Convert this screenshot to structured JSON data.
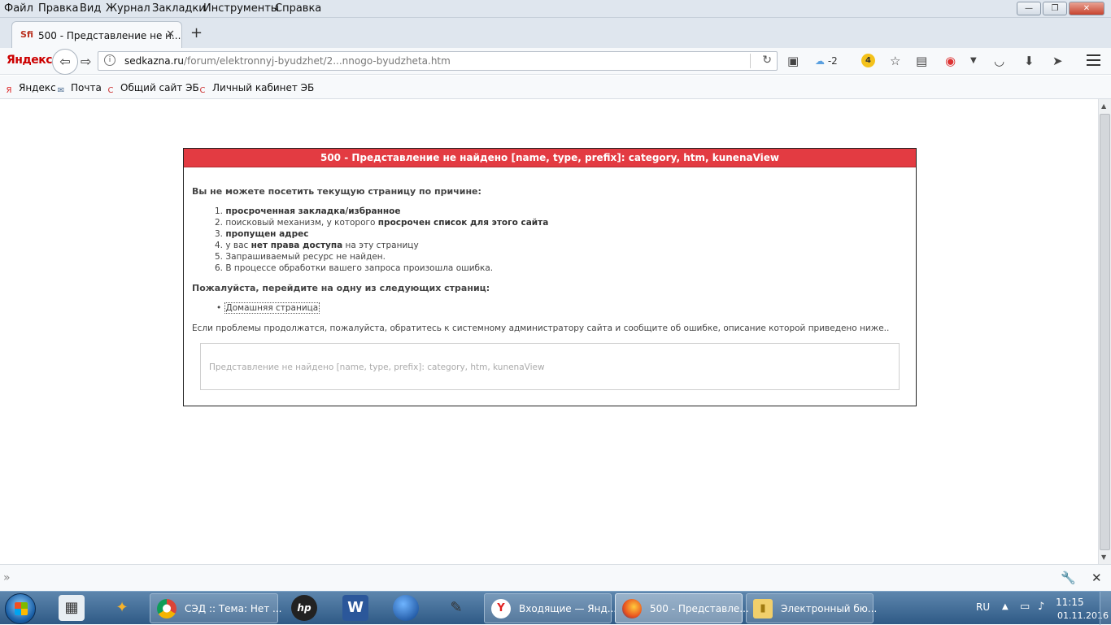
{
  "menu": {
    "items": [
      "Файл",
      "Правка",
      "Вид",
      "Журнал",
      "Закладки",
      "Инструменты",
      "Справка"
    ]
  },
  "window_controls": {
    "minimize": "—",
    "maximize": "❐",
    "close": "✕"
  },
  "tab": {
    "title": "500 - Представление не н...",
    "favicon": "Sfi",
    "close": "✕",
    "new_tab": "+"
  },
  "navbar": {
    "brand": "Яндекс",
    "back": "⇦",
    "forward": "⇨",
    "url_host": "sedkazna.ru",
    "url_path": "/forum/elektronnyj-byudzhet/2...nnogo-byudzheta.htm",
    "reload": "↻",
    "weather": "-2",
    "badge": "4"
  },
  "bookmarks": [
    {
      "label": "Яндекс",
      "icon": "yandex-icon",
      "glyph": "Я",
      "color": "#d22"
    },
    {
      "label": "Почта",
      "icon": "mail-icon",
      "glyph": "✉",
      "color": "#4a6a90"
    },
    {
      "label": "Общий сайт ЭБ",
      "icon": "eb-icon",
      "glyph": "C",
      "color": "#c33"
    },
    {
      "label": "Личный кабинет ЭБ",
      "icon": "eb-icon",
      "glyph": "C",
      "color": "#c33"
    }
  ],
  "error": {
    "header": "500 - Представление не найдено [name, type, prefix]: category, htm, kunenaView",
    "reason_title": "Вы не можете посетить текущую страницу по причине:",
    "reasons": [
      {
        "num": "1.",
        "pre": "",
        "bold": "просроченная закладка/избранное",
        "post": ""
      },
      {
        "num": "2.",
        "pre": "поисковый механизм, у которого ",
        "bold": "просрочен список для этого сайта",
        "post": ""
      },
      {
        "num": "3.",
        "pre": "",
        "bold": "пропущен адрес",
        "post": ""
      },
      {
        "num": "4.",
        "pre": "у вас ",
        "bold": "нет права доступа",
        "post": " на эту страницу"
      },
      {
        "num": "5.",
        "pre": "Запрашиваемый ресурс не найден.",
        "bold": "",
        "post": ""
      },
      {
        "num": "6.",
        "pre": "В процессе обработки вашего запроса произошла ошибка.",
        "bold": "",
        "post": ""
      }
    ],
    "goto_title": "Пожалуйста, перейдите на одну из следующих страниц:",
    "home_link": "Домашняя страница",
    "bullet": "•",
    "contact": "Если проблемы продолжатся, пожалуйста, обратитесь к системному администратору сайта и сообщите об ошибке, описание которой приведено ниже..",
    "detail": "Представление не найдено [name, type, prefix]: category, htm, kunenaView"
  },
  "addonbar": {
    "chevron": "»",
    "wrench": "🔧",
    "close": "✕"
  },
  "taskbar": {
    "tasks": [
      {
        "label": "СЭД :: Тема: Нет ...",
        "icon": "chrome-icon"
      },
      {
        "label": "Входящие — Янд...",
        "icon": "yandex-browser-icon"
      },
      {
        "label": "500 - Представле...",
        "icon": "firefox-icon"
      },
      {
        "label": "Электронный бю...",
        "icon": "folder-icon"
      }
    ],
    "lang": "RU",
    "time": "11:15",
    "date": "01.11.2016"
  },
  "colors": {
    "error_header": "#e33b42",
    "menubar": "#dfe6ee",
    "taskbar": "#2f5a86"
  }
}
